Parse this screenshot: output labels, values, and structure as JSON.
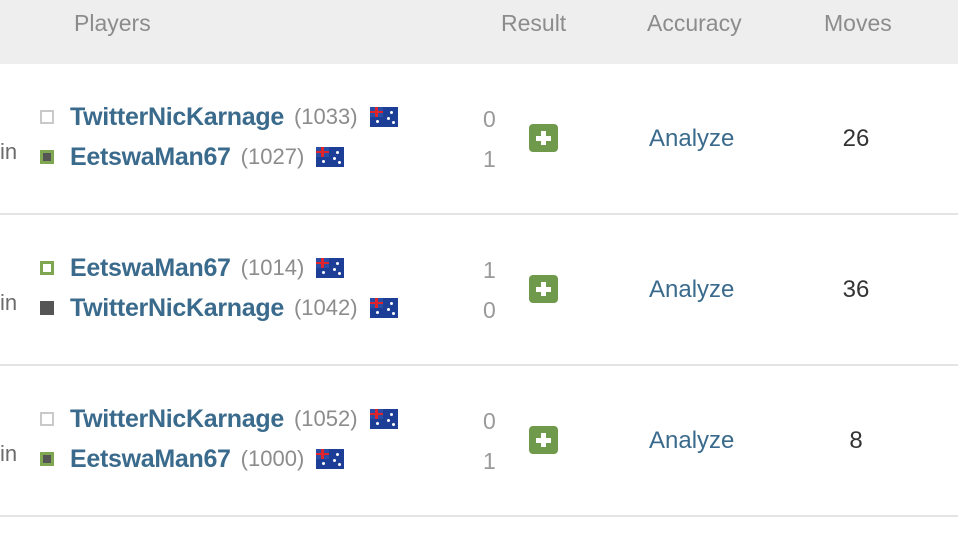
{
  "header": {
    "players": "Players",
    "result": "Result",
    "accuracy": "Accuracy",
    "moves": "Moves"
  },
  "colors": {
    "header_bg": "#eeeeee",
    "link": "#3a6a8c",
    "win_green": "#7fa650",
    "plus_green": "#6f9a4b"
  },
  "games": [
    {
      "clip_label": "in",
      "players": [
        {
          "name": "TwitterNicKarnage",
          "rating": "(1033)",
          "score": "0",
          "piece": "white",
          "flag": "australia-flag"
        },
        {
          "name": "EetswaMan67",
          "rating": "(1027)",
          "score": "1",
          "piece": "black-win",
          "flag": "australia-flag"
        }
      ],
      "analyze": "Analyze",
      "moves": "26"
    },
    {
      "clip_label": "in",
      "players": [
        {
          "name": "EetswaMan67",
          "rating": "(1014)",
          "score": "1",
          "piece": "white-win",
          "flag": "australia-flag"
        },
        {
          "name": "TwitterNicKarnage",
          "rating": "(1042)",
          "score": "0",
          "piece": "black",
          "flag": "australia-flag"
        }
      ],
      "analyze": "Analyze",
      "moves": "36"
    },
    {
      "clip_label": "in",
      "players": [
        {
          "name": "TwitterNicKarnage",
          "rating": "(1052)",
          "score": "0",
          "piece": "white",
          "flag": "australia-flag"
        },
        {
          "name": "EetswaMan67",
          "rating": "(1000)",
          "score": "1",
          "piece": "black-win",
          "flag": "australia-flag"
        }
      ],
      "analyze": "Analyze",
      "moves": "8"
    }
  ]
}
